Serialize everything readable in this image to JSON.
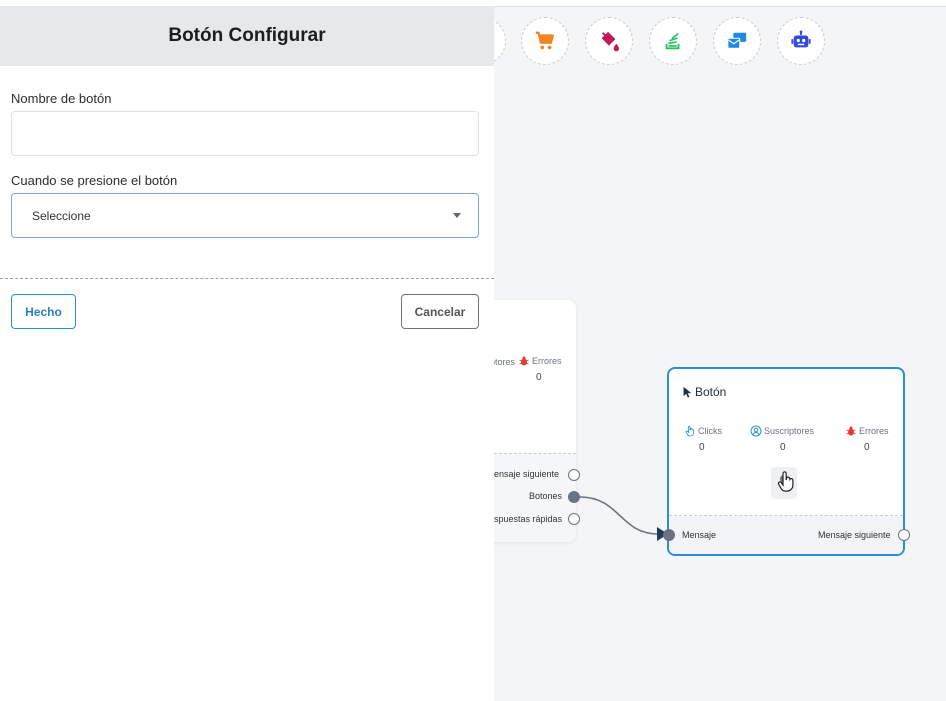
{
  "panel": {
    "title": "Botón Configurar",
    "name_label": "Nombre de botón",
    "name_value": "",
    "when_label": "Cuando se presione el botón",
    "select_value": "Seleccione",
    "done_label": "Hecho",
    "cancel_label": "Cancelar"
  },
  "toolbar": {
    "icons": [
      "cart-icon",
      "paint-bucket-icon",
      "stack-icon",
      "mail-cards-icon",
      "robot-icon"
    ],
    "colors": {
      "cart": "#f5821f",
      "paint": "#c2185b",
      "stack": "#22c55e",
      "mail": "#1e88e5",
      "robot": "#2f4ad8"
    }
  },
  "left_node": {
    "stat_label_1": "ptores",
    "stat_label_2": "Errores",
    "stat_value": "0",
    "ports": [
      "lensaje siguiente",
      "Botones",
      "spuestas rápidas"
    ]
  },
  "button_node": {
    "title": "Botón",
    "stats": [
      {
        "label": "Clicks",
        "value": "0"
      },
      {
        "label": "Suscriptores",
        "value": "0"
      },
      {
        "label": "Errores",
        "value": "0"
      }
    ],
    "input_port": "Mensaje",
    "output_port": "Mensaje siguiente"
  },
  "colors": {
    "accent": "#2a8fd8",
    "error": "#e53935",
    "port": "#6b7280"
  }
}
